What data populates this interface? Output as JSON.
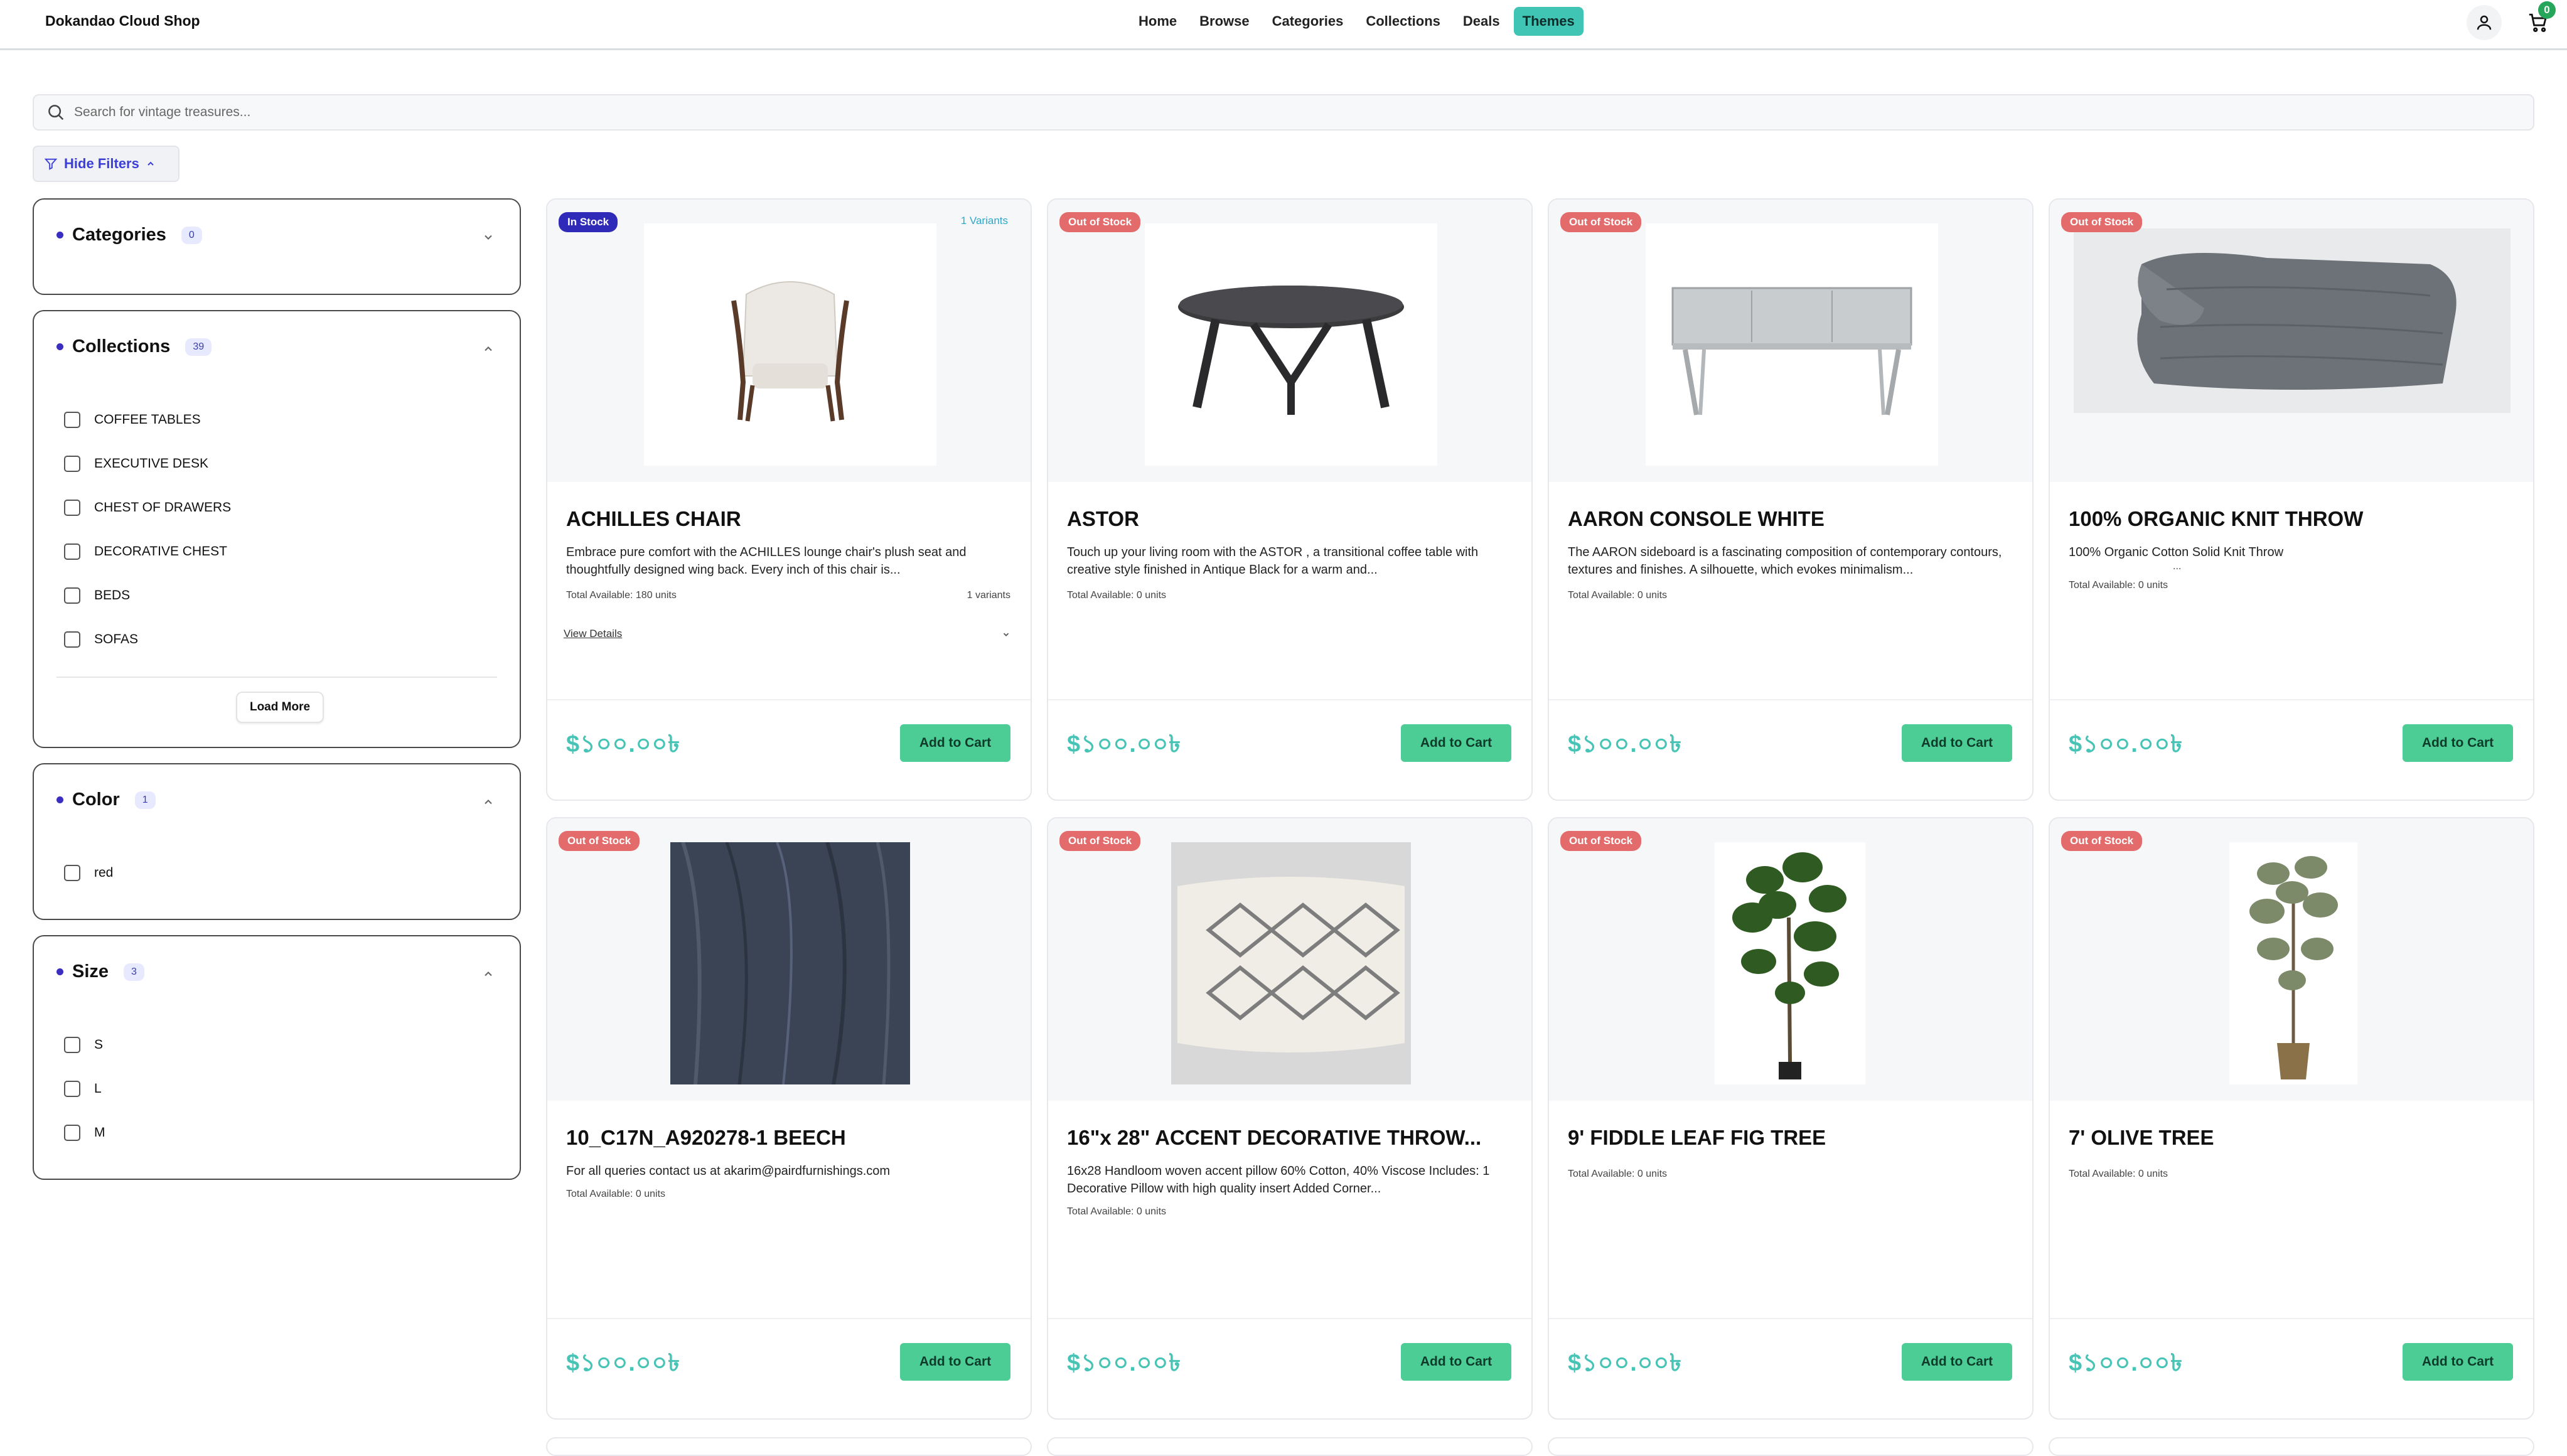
{
  "header": {
    "brand": "Dokandao Cloud Shop",
    "nav": [
      {
        "label": "Home",
        "active": false
      },
      {
        "label": "Browse",
        "active": false
      },
      {
        "label": "Categories",
        "active": false
      },
      {
        "label": "Collections",
        "active": false
      },
      {
        "label": "Deals",
        "active": false
      },
      {
        "label": "Themes",
        "active": true
      }
    ],
    "cart_count": "0",
    "icons": [
      "user-icon",
      "cart-icon"
    ]
  },
  "search": {
    "placeholder": "Search for vintage treasures..."
  },
  "filters_toggle": {
    "label": "Hide Filters"
  },
  "filters": {
    "categories": {
      "title": "Categories",
      "count": "0"
    },
    "collections": {
      "title": "Collections",
      "count": "39",
      "options": [
        "COFFEE TABLES",
        "EXECUTIVE DESK",
        "CHEST OF DRAWERS",
        "DECORATIVE CHEST",
        "BEDS",
        "SOFAS"
      ],
      "load_more": "Load More"
    },
    "color": {
      "title": "Color",
      "count": "1",
      "options": [
        "red"
      ]
    },
    "size": {
      "title": "Size",
      "count": "3",
      "options": [
        "S",
        "L",
        "M"
      ]
    }
  },
  "products": [
    {
      "title": "ACHILLES CHAIR",
      "stock": "In Stock",
      "variants_badge": "1 Variants",
      "description": "Embrace pure comfort with the ACHILLES lounge chair's plush seat and thoughtfully designed wing back. Every inch of this chair is...",
      "total": "Total Available: 180 units",
      "variants": "1 variants",
      "view_details": "View Details",
      "price": "$১০০.০০৳",
      "add_to_cart": "Add to Cart"
    },
    {
      "title": "ASTOR",
      "stock": "Out of Stock",
      "description": "Touch up your living room with the ASTOR , a transitional coffee table with creative style finished in Antique Black for a warm and...",
      "total": "Total Available: 0 units",
      "price": "$১০০.০০৳",
      "add_to_cart": "Add to Cart"
    },
    {
      "title": "AARON CONSOLE WHITE",
      "stock": "Out of Stock",
      "description": "The AARON sideboard is a fascinating composition of contemporary contours, textures and finishes. A silhouette, which evokes minimalism...",
      "total": "Total Available: 0 units",
      "price": "$১০০.০০৳",
      "add_to_cart": "Add to Cart"
    },
    {
      "title": "100% ORGANIC KNIT THROW",
      "stock": "Out of Stock",
      "description": "100% Organic Cotton Solid Knit Throw",
      "description_extra": "...",
      "total": "Total Available: 0 units",
      "price": "$১০০.০০৳",
      "add_to_cart": "Add to Cart"
    },
    {
      "title": "10_C17N_A920278-1 BEECH",
      "stock": "Out of Stock",
      "description": "For all queries contact us at akarim@pairdfurnishings.com",
      "total": "Total Available: 0 units",
      "price": "$১০০.০০৳",
      "add_to_cart": "Add to Cart"
    },
    {
      "title": "16\"x 28\" ACCENT DECORATIVE THROW...",
      "stock": "Out of Stock",
      "description": "16x28 Handloom woven accent pillow 60% Cotton, 40% Viscose Includes: 1 Decorative Pillow with high quality insert Added Corner...",
      "total": "Total Available: 0 units",
      "price": "$১০০.০০৳",
      "add_to_cart": "Add to Cart"
    },
    {
      "title": "9' FIDDLE LEAF FIG TREE",
      "stock": "Out of Stock",
      "total": "Total Available: 0 units",
      "price": "$১০০.০০৳",
      "add_to_cart": "Add to Cart"
    },
    {
      "title": "7' OLIVE TREE",
      "stock": "Out of Stock",
      "total": "Total Available: 0 units",
      "price": "$১০০.০০৳",
      "add_to_cart": "Add to Cart"
    }
  ],
  "colors": {
    "accent": "#40c4b4",
    "price": "#48c4b6",
    "button": "#4ccd95",
    "in_stock": "#2f2bb8",
    "out_stock": "#e36b6b"
  }
}
